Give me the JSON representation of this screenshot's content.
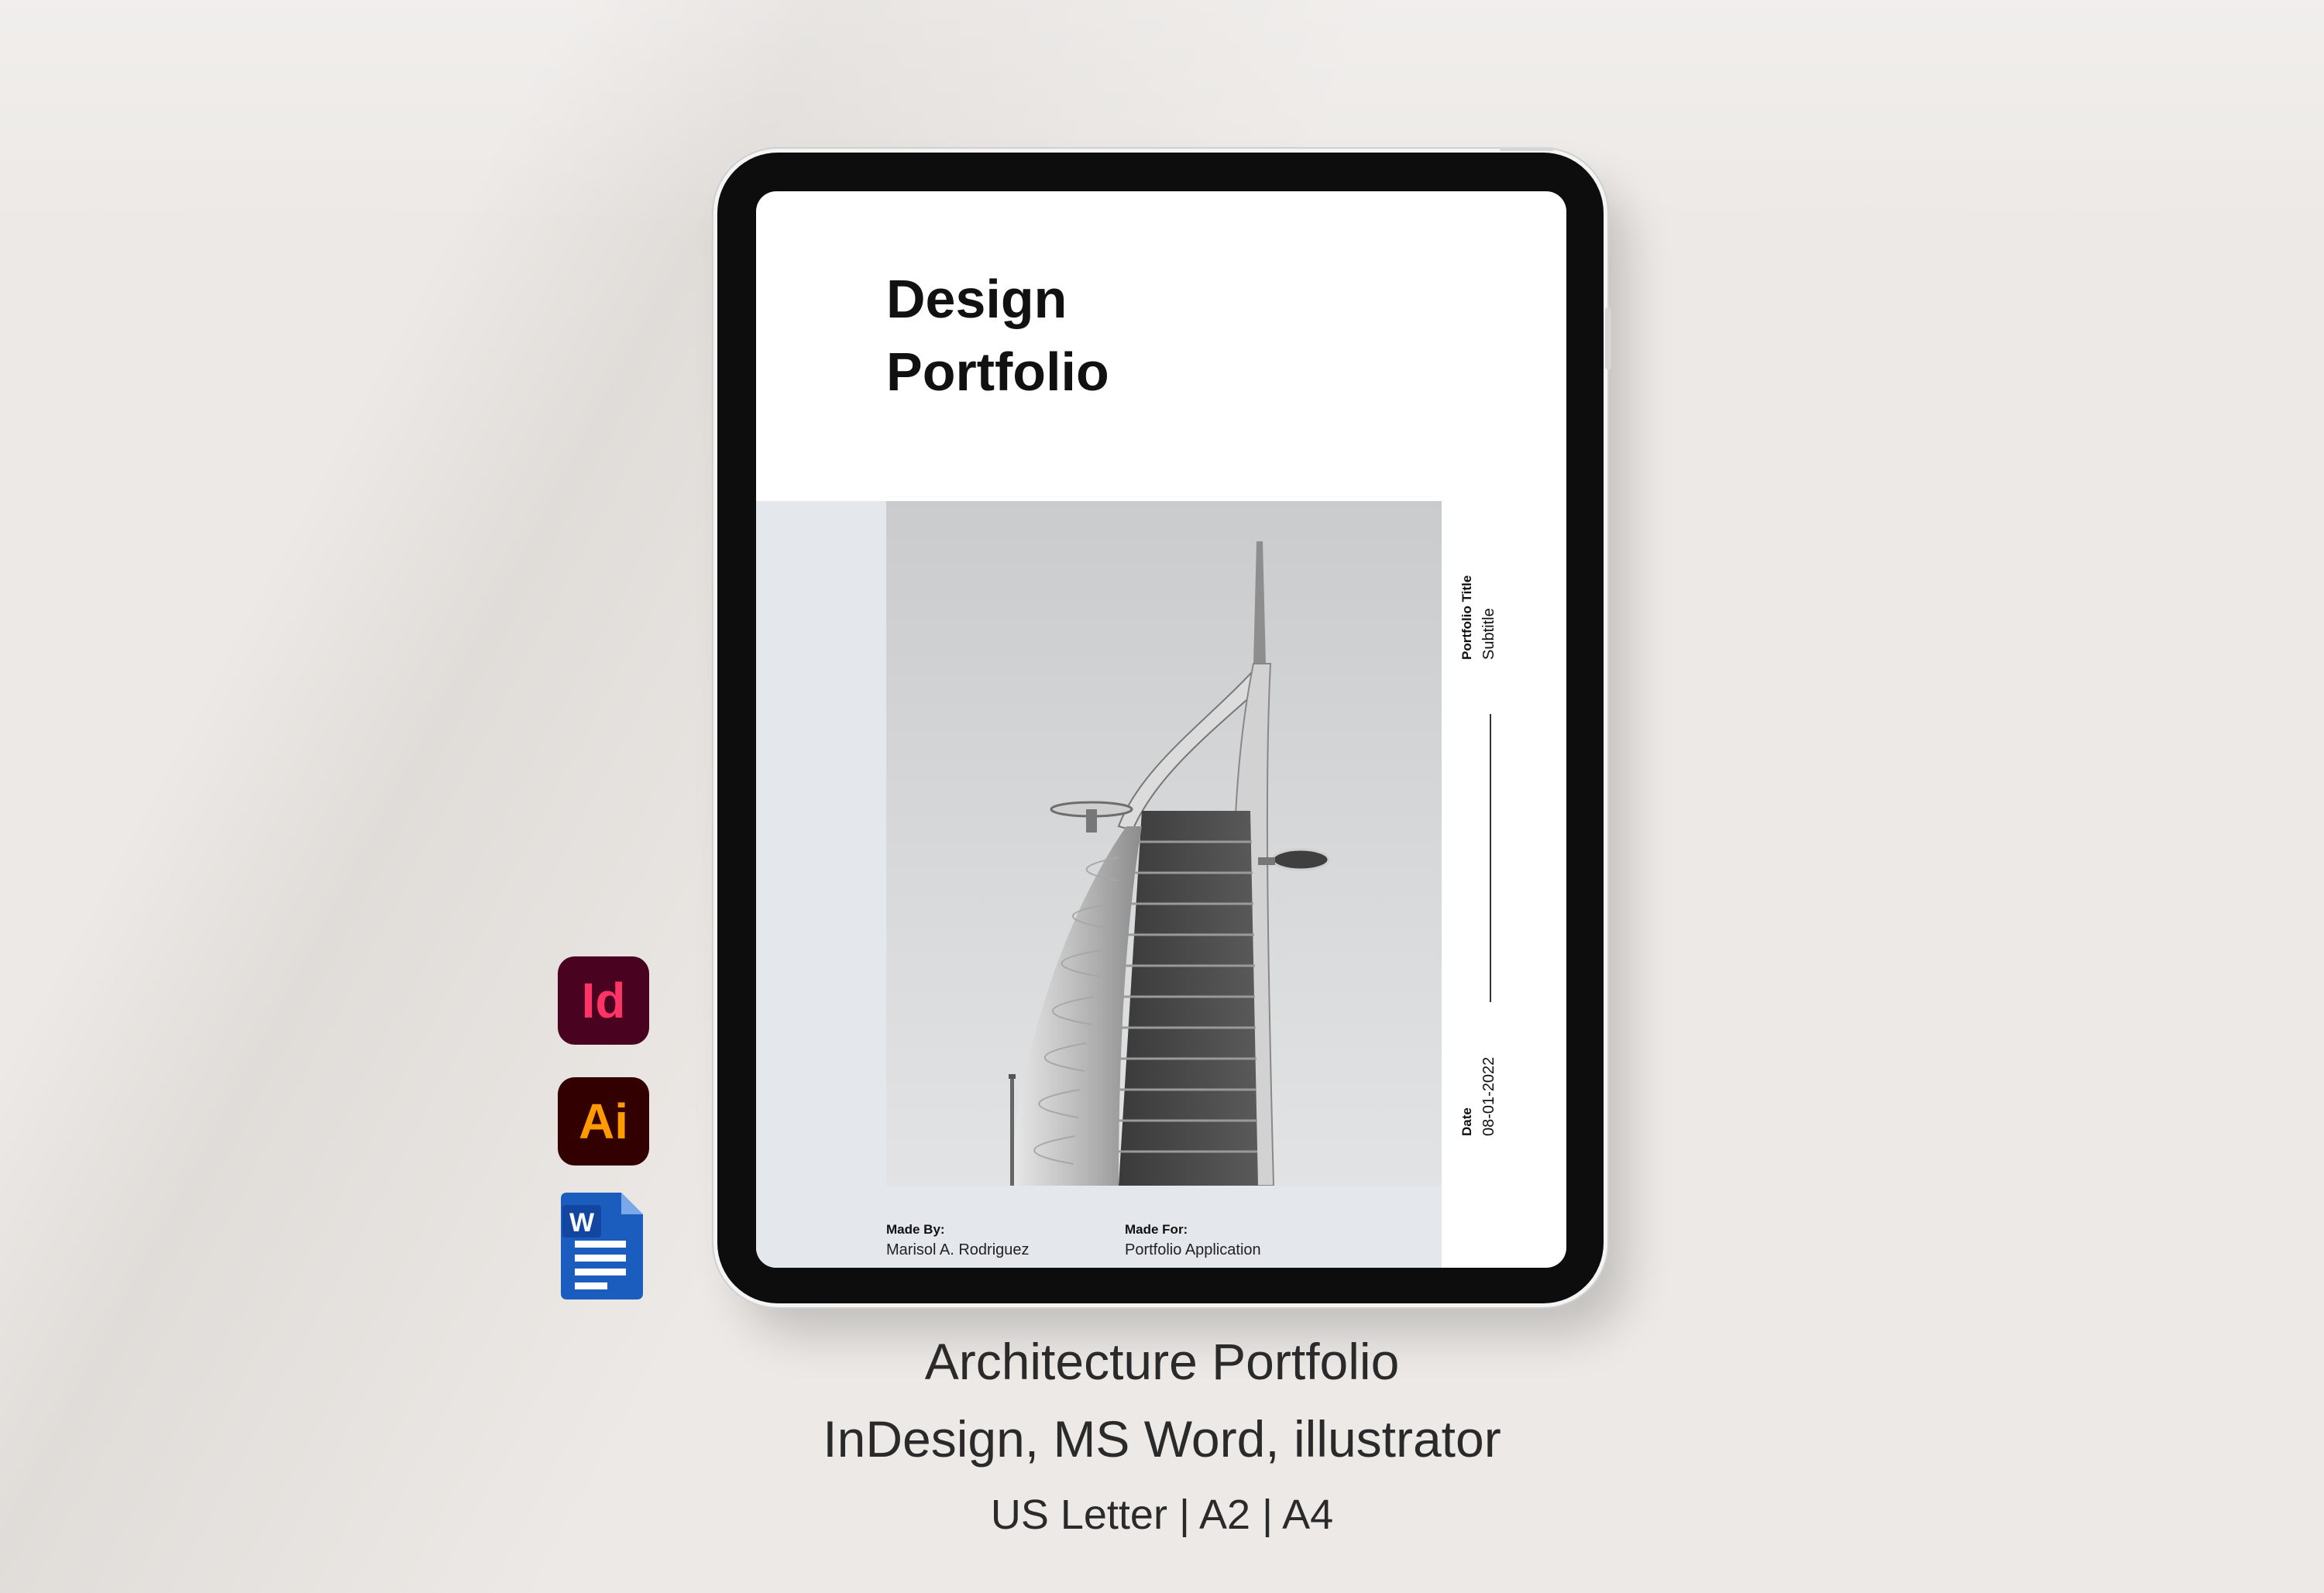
{
  "cover": {
    "title_line1": "Design",
    "title_line2": "Portfolio",
    "portfolio_title": "Portfolio Title",
    "subtitle": "Subtitle",
    "date_label": "Date",
    "date_value": "08-01-2022",
    "made_by_label": "Made By:",
    "made_by_value": "Marisol A. Rodriguez",
    "made_for_label": "Made For:",
    "made_for_value": "Portfolio Application"
  },
  "apps": [
    {
      "icon": "indesign-icon",
      "label": "Id",
      "bg": "#49021f",
      "fg": "#ff3366"
    },
    {
      "icon": "illustrator-icon",
      "label": "Ai",
      "bg": "#330000",
      "fg": "#ff9a00"
    },
    {
      "icon": "word-icon",
      "label": "W",
      "bg": "#1a5dbf",
      "fg": "#ffffff"
    }
  ],
  "captions": {
    "line1": "Architecture Portfolio",
    "line2": "InDesign, MS Word, illustrator",
    "line3": "US Letter | A2 | A4"
  },
  "colors": {
    "background": "#ece9e6",
    "panel": "#e4e8ec",
    "tablet": "#0d0d0d"
  }
}
